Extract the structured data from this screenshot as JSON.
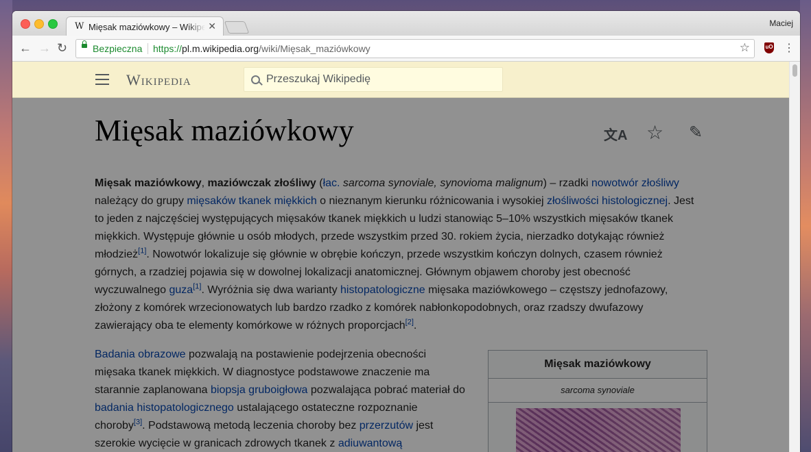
{
  "browser": {
    "tab_favicon": "W",
    "tab_title": "Mięsak maziówkowy – Wikipedia",
    "tab_close": "✕",
    "profile_name": "Maciej",
    "secure_label": "Bezpieczna",
    "url_scheme": "https://",
    "url_host": "pl.m.wikipedia.org",
    "url_path": "/wiki/Mięsak_maziówkowy",
    "icons": [
      "back-arrow-icon",
      "forward-arrow-icon",
      "reload-icon",
      "lock-icon",
      "bookmark-star-icon",
      "ublock-icon",
      "menu-dots-icon"
    ]
  },
  "wiki": {
    "logo": "Wikipedia",
    "search_placeholder": "Przeszukaj Wikipedię"
  },
  "article": {
    "title": "Mięsak maziówkowy",
    "p1": {
      "b1": "Mięsak maziówkowy",
      "s1": ", ",
      "b2": "maziówczak złośliwy",
      "s2": " (",
      "a_lac": "łac.",
      "i1": " sarcoma synoviale, synovioma malignum",
      "s3": ") – rzadki ",
      "a1": "nowotwór złośliwy",
      "s4": " należący do grupy ",
      "a2": "mięsaków tkanek miękkich",
      "s5": " o nieznanym kierunku różnicowania i wysokiej ",
      "a3": "złośliwości histologicznej",
      "s6": ". Jest to jeden z najczęściej występujących mięsaków tkanek miękkich u ludzi stanowiąc 5–10% wszystkich mięsaków tkanek miękkich. Występuje głównie u osób młodych, przede wszystkim przed 30. rokiem życia, nierzadko dotykając również młodzież",
      "ref1": "[1]",
      "s7": ". Nowotwór lokalizuje się głównie w obrębie kończyn, przede wszystkim kończyn dolnych, czasem również górnych, a rzadziej pojawia się w dowolnej lokalizacji anatomicznej. Głównym objawem choroby jest obecność wyczuwalnego ",
      "a4": "guza",
      "ref2": "[1]",
      "s8": ". Wyróżnia się dwa warianty ",
      "a5": "histopatologiczne",
      "s9": " mięsaka maziówkowego – częstszy jednofazowy, złożony z komórek wrzecionowatych lub bardzo rzadko z komórek nabłonkopodobnych, oraz rzadszy dwufazowy zawierający oba te elementy komórkowe w różnych proporcjach",
      "ref3": "[2]",
      "s10": "."
    },
    "p2": {
      "a1": "Badania obrazowe",
      "s1": " pozwalają na postawienie podejrzenia obecności mięsaka tkanek miękkich. W diagnostyce podstawowe znaczenie ma starannie zaplanowana ",
      "a2": "biopsja gruboigłowa",
      "s2": " pozwalająca pobrać materiał do ",
      "a3": "badania histopatologicznego",
      "s3": " ustalającego ostateczne rozpoznanie choroby",
      "ref1": "[3]",
      "s4": ". Podstawową metodą leczenia choroby bez ",
      "a4": "przerzutów",
      "s5": " jest szerokie wycięcie w granicach zdrowych tkanek z ",
      "a5": "adiuwantową"
    },
    "infobox": {
      "title": "Mięsak maziówkowy",
      "subtitle": "sarcoma synoviale"
    }
  }
}
